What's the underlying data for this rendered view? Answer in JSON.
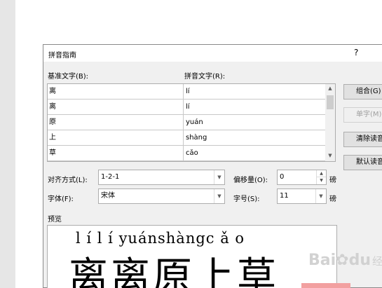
{
  "dialog": {
    "title": "拼音指南",
    "help": "?"
  },
  "labels": {
    "base_text": "基准文字(B):",
    "pinyin_text": "拼音文字(R):",
    "alignment": "对齐方式(L):",
    "offset": "偏移量(O):",
    "font": "字体(F):",
    "size": "字号(S):",
    "preview": "预览",
    "offset_unit": "磅",
    "size_unit": "磅"
  },
  "rows": [
    {
      "base": "离",
      "pinyin": "lí"
    },
    {
      "base": "离",
      "pinyin": "lí"
    },
    {
      "base": "原",
      "pinyin": "yuán"
    },
    {
      "base": "上",
      "pinyin": "shàng"
    },
    {
      "base": "草",
      "pinyin": "cǎo"
    }
  ],
  "buttons": {
    "combine": "组合(G)",
    "single": "单字(M)",
    "clear": "清除读音(C)",
    "default": "默认读音(D)"
  },
  "fields": {
    "alignment": "1-2-1",
    "offset": "0",
    "font": "宋体",
    "size": "11"
  },
  "preview": {
    "pinyin": "l í l í yuánshàngc ǎ o",
    "hanzi": "离离原上草"
  },
  "watermark": {
    "brand": "Bai",
    "paw": "✿",
    "brand2": "du",
    "sub": "经验"
  }
}
